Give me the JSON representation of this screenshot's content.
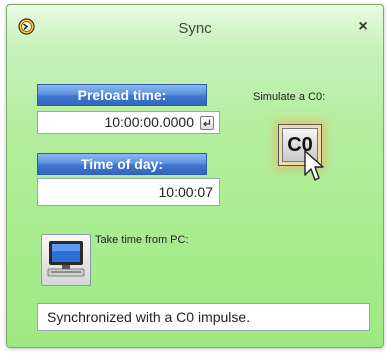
{
  "window": {
    "title": "Sync",
    "close_label": "×"
  },
  "preload": {
    "label": "Preload time:",
    "value": "10:00:00.0000"
  },
  "time_of_day": {
    "label": "Time of day:",
    "value": "10:00:07"
  },
  "simulate": {
    "label": "Simulate a C0:",
    "button_label": "C0"
  },
  "pc": {
    "label": "Take time from PC:"
  },
  "status": {
    "text": "Synchronized with a C0 impulse."
  },
  "icons": {
    "app": "sync-clock-icon",
    "enter": "enter-key-icon",
    "cursor": "mouse-pointer-icon",
    "computer": "computer-icon"
  },
  "colors": {
    "label_bar": "#4077d0",
    "window_background": "#b4ee9f",
    "c0_glow": "#ffa050"
  }
}
